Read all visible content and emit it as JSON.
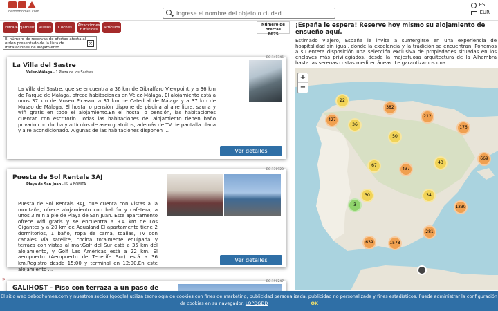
{
  "header": {
    "logo_text": "debodhomes.com",
    "search_placeholder": "ingrese el nombre del objeto o ciudad",
    "language": "ES",
    "currency": "EUR"
  },
  "filters": [
    {
      "label": "Filtrar"
    },
    {
      "label": "Alojamientos"
    },
    {
      "label": "Vuelos"
    },
    {
      "label": "Coches"
    },
    {
      "label": "Atracciones turísticas"
    },
    {
      "label": "Artículos"
    }
  ],
  "offers": {
    "label": "Número de ofertas",
    "count": "8675"
  },
  "notice": {
    "text": "El número de reservas de ofertas afecta al orden presentado de la lista de instalaciones de alojamiento."
  },
  "listings": [
    {
      "ref": "BG.141345",
      "title": "La Villa del Sastre",
      "town": "Vélez-Málaga",
      "address": "1 Plaza de los Sastres",
      "description": "La Villa del Sastre, que se encuentra a 36 km de Gibralfaro Viewpoint y a 36 km de Parque de Málaga, ofrece habitaciones en Vélez-Málaga. El alojamiento está a unos 37 km de Museo Picasso, a 37 km de Catedral de Málaga y a 37 km de Museo de Málaga. El hostal o pensión dispone de piscina al aire libre, sauna y wifi gratis en todo el alojamiento.En el hostal o pensión, las habitaciones cuentan con escritorio. Todas las habitaciones del alojamiento tienen baño privado con ducha y artículos de aseo gratuitos, además de TV de pantalla plana y aire acondicionado. Algunas de las habitaciones disponen ...",
      "button": "Ver detalles"
    },
    {
      "ref": "BG.130920",
      "title": "Puesta de Sol Rentals 3AJ",
      "town": "Playa de San Juan",
      "address": "ISLA BONITA",
      "description": "Puesta de Sol Rentals 3AJ, que cuenta con vistas a la montaña, ofrece alojamiento con balcón y cafetera, a unos 3 min a pie de Playa de San Juan. Este apartamento ofrece wifi gratis y se encuentra a 9.4 km de Los Gigantes y a 20 km de Aqualand.El apartamento tiene 2 dormitorios, 1 baño, ropa de cama, toallas, TV con canales vía satélite, cocina totalmente equipada y terraza con vistas al mar.Golf del Sur está a 35 km del alojamiento, y Golf Las Américas está a 22 km. El aeropuerto (Aeropuerto de Tenerife Sur) está a 36 km.Registro desde 15:00 y terminal en 12:00.En este alojamiento ...",
      "button": "Ver detalles"
    },
    {
      "ref": "BG.190247",
      "title": "GALIHOST - Piso con terraza a un paso de"
    }
  ],
  "panel": {
    "heading": "¡España le espera! Reserve hoy mismo su alojamiento de ensueño aquí.",
    "text": "Estimado viajero, España le invita a sumergirse en una experiencia de hospitalidad sin igual, donde la excelencia y la tradición se encuentran. Ponemos a su entera disposición una selección exclusiva de propiedades situadas en los enclaves más privilegiados, desde la majestuosa arquitectura de la Alhambra hasta las serenas costas mediterráneas. Le garantizamos una"
  },
  "map": {
    "zoom_in": "+",
    "zoom_out": "−",
    "clusters": [
      {
        "count": "22",
        "color": "yellow"
      },
      {
        "count": "382",
        "color": "orange"
      },
      {
        "count": "427",
        "color": "orange"
      },
      {
        "count": "36",
        "color": "yellow"
      },
      {
        "count": "212",
        "color": "orange"
      },
      {
        "count": "176",
        "color": "orange"
      },
      {
        "count": "50",
        "color": "yellow"
      },
      {
        "count": "67",
        "color": "yellow"
      },
      {
        "count": "437",
        "color": "orange"
      },
      {
        "count": "43",
        "color": "yellow"
      },
      {
        "count": "669",
        "color": "orange"
      },
      {
        "count": "30",
        "color": "yellow"
      },
      {
        "count": "34",
        "color": "yellow"
      },
      {
        "count": "3",
        "color": "green"
      },
      {
        "count": "1330",
        "color": "orange"
      },
      {
        "count": "281",
        "color": "orange"
      },
      {
        "count": "639",
        "color": "orange"
      },
      {
        "count": "1578",
        "color": "orange"
      }
    ]
  },
  "cookie": {
    "text_before": "El sitio web debodhomes.com y nuestros socios (",
    "google": "google",
    "text_after": ") utiliza tecnología de cookies con fines de marketing, publicidad personalizada, publicidad no personalizada y fines estadísticos. Puede administrar la configuración de cookies en su navegador.",
    "link": "LOPDGDD",
    "ok": "OK"
  }
}
